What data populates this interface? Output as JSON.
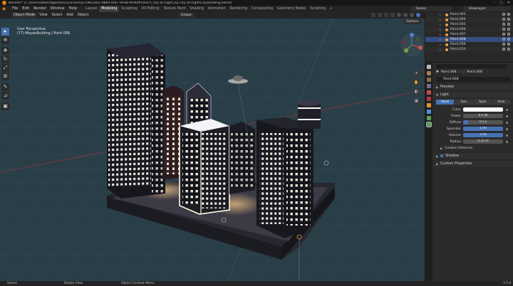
{
  "window": {
    "title": "Blender* [C:\\Users\\alber\\AppData\\Local\\Temp\\708c2a62-0b6d-4f87-9e58-9090f0f3ed7f_city-at-night.zip.city-at-night\\CityBuilding.blend]"
  },
  "menu": [
    "File",
    "Edit",
    "Render",
    "Window",
    "Help"
  ],
  "workspaces": {
    "tabs": [
      "Layout",
      "Modeling",
      "Sculpting",
      "UV Editing",
      "Texture Paint",
      "Shading",
      "Animation",
      "Rendering",
      "Compositing",
      "Geometry Nodes",
      "Scripting",
      "+"
    ],
    "active": "Modeling"
  },
  "scene": {
    "label": "Scene"
  },
  "view_layer": {
    "label": "ViewLayer"
  },
  "viewport": {
    "mode": "Object Mode",
    "menu": [
      "View",
      "Select",
      "Add",
      "Object"
    ],
    "transform_orientation": "Global",
    "options_label": "Options",
    "perspective": "User Perspective",
    "object_info": "(77) MayanBuilding | Point.008"
  },
  "outliner": {
    "items": [
      "Point.003",
      "Point.004",
      "Point.005",
      "Point.006",
      "Point.007",
      "Point.008",
      "Point.009",
      "Point.010"
    ],
    "selected": "Point.008"
  },
  "properties": {
    "breadcrumb_object": "Point.008",
    "breadcrumb_data": "Point.008",
    "data_name": "Point.008",
    "sections": {
      "preview": "Preview",
      "light": "Light",
      "custom_distance": "Custom Distance",
      "shadow": "Shadow",
      "custom_properties": "Custom Properties"
    },
    "light_types": [
      "Point",
      "Sun",
      "Spot",
      "Area"
    ],
    "active_light_type": "Point",
    "fields": [
      {
        "label": "Color",
        "value": "",
        "kind": "color",
        "color": "#fafafa"
      },
      {
        "label": "Power",
        "value": "4.5 W",
        "kind": "plain"
      },
      {
        "label": "Diffuse",
        "value": "0.13",
        "kind": "slider",
        "fraction": 0.13
      },
      {
        "label": "Specular",
        "value": "1.00",
        "kind": "slider",
        "fraction": 1.0
      },
      {
        "label": "Volume",
        "value": "1.00",
        "kind": "slider",
        "fraction": 1.0
      },
      {
        "label": "Radius",
        "value": "0.25 m",
        "kind": "plain"
      }
    ]
  },
  "statusbar": {
    "select": "Select",
    "rotate": "Rotate View",
    "context": "Object Context Menu",
    "version": "3.5.0"
  },
  "colors": {
    "accent": "#4772b3",
    "viewport_bg": "#2a3e48",
    "blender_orange": "#e87d0d"
  }
}
